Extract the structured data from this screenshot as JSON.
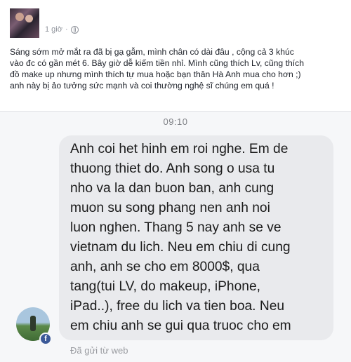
{
  "post": {
    "time": "1 giờ",
    "separator": "·",
    "lines": [
      "Sáng sớm mở mắt ra đã bị gạ gẫm, mình chân có dài đâu , cộng cả 3 khúc",
      "vào đc có gần mét 6. Bây giờ dễ kiếm tiền nhỉ. Mình cũng thích Lv, cũng thích",
      "đồ make up nhưng mình thích tự mua hoặc bạn thân Hà Anh mua cho hơn ;)",
      "anh này bị ảo tưởng sức mạnh và coi thường nghệ sĩ chúng em quá !"
    ]
  },
  "messenger": {
    "timestamp": "09:10",
    "message_lines": [
      "Anh coi het hinh em roi nghe. Em de",
      "thuong thiet do. Anh song o usa tu",
      "nho va la dan buon ban, anh cung",
      "muon su song phang nen anh noi",
      "luon nghen. Thang 5 nay anh se ve",
      "vietnam du lich. Neu em chiu di cung",
      "anh, anh se cho em 8000$, qua",
      "tang(tui LV, do makeup, iPhone,",
      "iPad..), free du lich va tien boa. Neu",
      "em chiu anh se gui qua truoc cho em"
    ],
    "sent_via": "Đã gửi từ web",
    "badge_letter": "f"
  }
}
